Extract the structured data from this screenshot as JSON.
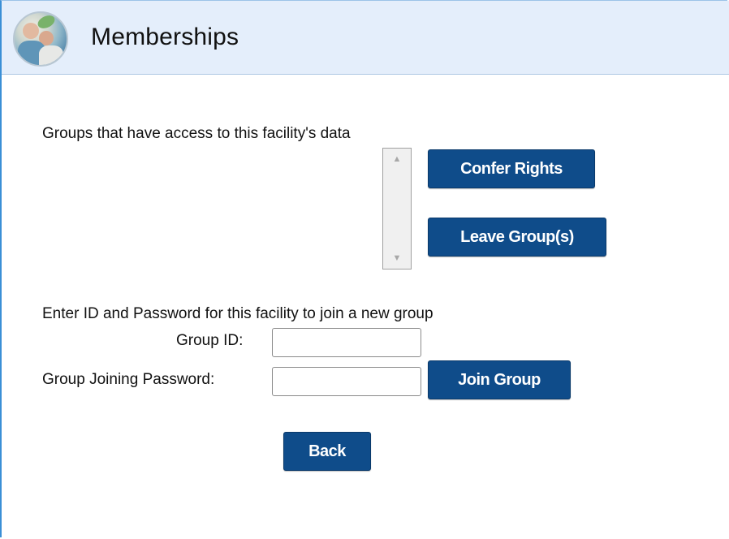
{
  "header": {
    "title": "Memberships",
    "logo_icon": "facility-photo-icon"
  },
  "groups": {
    "heading": "Groups that have access to this facility's data",
    "confer_label": "Confer Rights",
    "leave_label": "Leave Group(s)",
    "list_items": []
  },
  "join": {
    "heading": "Enter ID and Password for this facility to join a new group",
    "group_id_label": "Group ID:",
    "group_id_value": "",
    "password_label": "Group Joining Password:",
    "password_value": "",
    "join_label": "Join Group"
  },
  "back_label": "Back",
  "colors": {
    "button_bg": "#0f4c8a",
    "header_bg": "#e4eefb",
    "frame_border": "#3a8fd6"
  }
}
